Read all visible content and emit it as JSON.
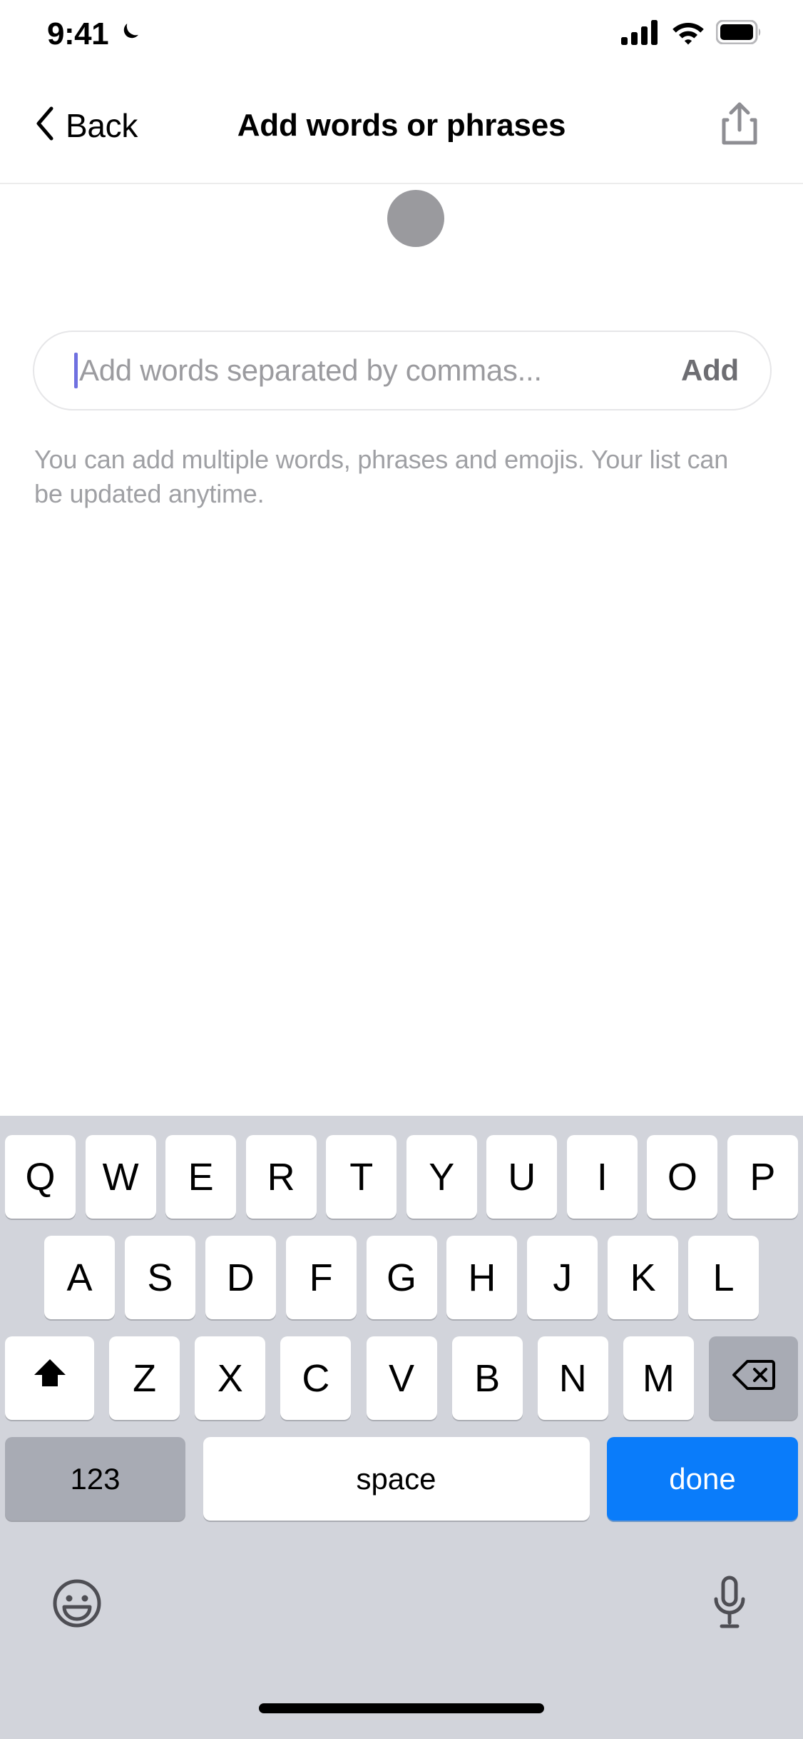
{
  "status_bar": {
    "time": "9:41",
    "dnd_icon": "crescent-moon-icon",
    "signal_icon": "cellular-signal-icon",
    "wifi_icon": "wifi-icon",
    "battery_icon": "battery-full-icon"
  },
  "nav_bar": {
    "back_label": "Back",
    "back_icon": "chevron-left-icon",
    "title": "Add words or phrases",
    "share_icon": "share-upload-icon"
  },
  "content": {
    "avatar": "avatar-placeholder-circle",
    "input": {
      "value": "",
      "placeholder": "Add words separated by commas...",
      "add_label": "Add",
      "caret_color": "#6f70e0"
    },
    "helper_text": "You can add multiple words, phrases and emojis. Your list can be updated anytime."
  },
  "keyboard": {
    "row1": [
      "Q",
      "W",
      "E",
      "R",
      "T",
      "Y",
      "U",
      "I",
      "O",
      "P"
    ],
    "row2": [
      "A",
      "S",
      "D",
      "F",
      "G",
      "H",
      "J",
      "K",
      "L"
    ],
    "row3_letters": [
      "Z",
      "X",
      "C",
      "V",
      "B",
      "N",
      "M"
    ],
    "shift_icon": "shift-arrow-up-icon",
    "backspace_icon": "backspace-delete-icon",
    "numeric_label": "123",
    "space_label": "space",
    "done_label": "done",
    "done_color": "#0a7cfa",
    "emoji_icon": "emoji-smiley-icon",
    "mic_icon": "microphone-icon",
    "background_color": "#d2d4db"
  },
  "home_indicator": "home-indicator-bar"
}
